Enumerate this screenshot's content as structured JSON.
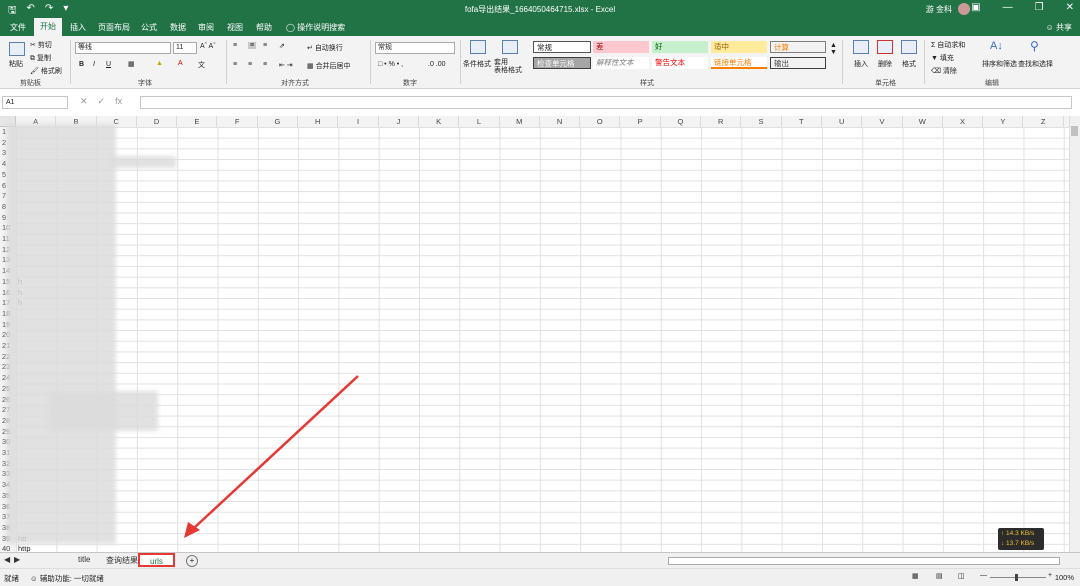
{
  "window": {
    "title": "fofa导出结果_1664050464715.xlsx - Excel",
    "user": "游 金科",
    "share": "共享"
  },
  "ribbon_tabs": [
    "文件",
    "开始",
    "插入",
    "页面布局",
    "公式",
    "数据",
    "审阅",
    "视图",
    "帮助",
    "操作说明搜索"
  ],
  "clipboard": {
    "paste": "粘贴",
    "cut": "剪切",
    "copy": "复制",
    "format_painter": "格式刷",
    "group": "剪贴板"
  },
  "font": {
    "name": "等线",
    "size": "11",
    "group": "字体"
  },
  "alignment": {
    "wrap": "自动换行",
    "merge": "合并后居中",
    "group": "对齐方式"
  },
  "number": {
    "format": "常规",
    "group": "数字"
  },
  "styles": {
    "cond_format": "条件格式",
    "table_format": "套用\n表格格式",
    "cells": [
      {
        "label": "常规",
        "bg": "#ffffff",
        "color": "#222"
      },
      {
        "label": "差",
        "bg": "#ffc7ce",
        "color": "#9c0006"
      },
      {
        "label": "好",
        "bg": "#c6efce",
        "color": "#006100"
      },
      {
        "label": "适中",
        "bg": "#ffeb9c",
        "color": "#9c5700"
      },
      {
        "label": "计算",
        "bg": "#f2f2f2",
        "color": "#fa7d00"
      },
      {
        "label": "检查单元格",
        "bg": "#a5a5a5",
        "color": "#ffffff"
      },
      {
        "label": "解释性文本",
        "bg": "#ffffff",
        "color": "#7f7f7f"
      },
      {
        "label": "警告文本",
        "bg": "#ffffff",
        "color": "#ff0000"
      },
      {
        "label": "链接单元格",
        "bg": "#ffffff",
        "color": "#fa7d00"
      },
      {
        "label": "输出",
        "bg": "#f2f2f2",
        "color": "#3f3f3f"
      }
    ],
    "group": "样式"
  },
  "cells_group": {
    "insert": "插入",
    "delete": "删除",
    "format": "格式",
    "group": "单元格"
  },
  "editing": {
    "autosum": "自动求和",
    "fill": "填充",
    "clear": "清除",
    "sort": "排序和筛选",
    "find": "查找和选择",
    "group": "编辑"
  },
  "formula_bar": {
    "name_box": "A1",
    "value": ""
  },
  "columns": [
    "A",
    "B",
    "C",
    "D",
    "E",
    "F",
    "G",
    "H",
    "I",
    "J",
    "K",
    "L",
    "M",
    "N",
    "O",
    "P",
    "Q",
    "R",
    "S",
    "T",
    "U",
    "V",
    "W",
    "X",
    "Y",
    "Z"
  ],
  "rows": [
    "1",
    "2",
    "3",
    "4",
    "5",
    "6",
    "7",
    "8",
    "9",
    "10",
    "11",
    "12",
    "13",
    "14",
    "15",
    "16",
    "17",
    "18",
    "19",
    "20",
    "21",
    "22",
    "23",
    "24",
    "25",
    "26",
    "27",
    "28",
    "29",
    "30",
    "31",
    "32",
    "33",
    "34",
    "35",
    "36",
    "37",
    "38",
    "39",
    "40"
  ],
  "visible_cells": [
    {
      "row": "15",
      "text": "h"
    },
    {
      "row": "16",
      "text": "h"
    },
    {
      "row": "17",
      "text": "h"
    },
    {
      "row": "39",
      "text": "htt"
    },
    {
      "row": "40",
      "text": "http"
    }
  ],
  "sheet_tabs": [
    "title",
    "查询结果",
    "urls"
  ],
  "active_sheet": "urls",
  "status": {
    "ready": "就绪",
    "accessibility": "辅助功能: 一切就绪",
    "zoom": "100%"
  },
  "network": {
    "up": "↑ 14.3 KB/s",
    "down": "↓ 13.7 KB/s"
  },
  "annotation_color": "#e53935"
}
